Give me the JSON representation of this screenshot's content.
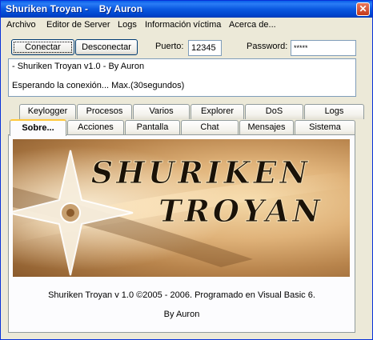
{
  "window": {
    "title": "Shuriken Troyan -    By Auron",
    "close_glyph": "✕"
  },
  "menu": [
    "Archivo",
    "Editor de Server",
    "Logs",
    "Información víctima",
    "Acerca de..."
  ],
  "toolbar": {
    "connect_label": "Conectar",
    "disconnect_label": "Desconectar",
    "port_label": "Puerto:",
    "port_value": "12345",
    "password_label": "Password:",
    "password_value": "*****"
  },
  "log": {
    "line1": "- Shuriken Troyan v1.0 -     By Auron",
    "line2": "Esperando la conexión... Max.(30segundos)"
  },
  "tabs_row1": [
    "Keylogger",
    "Procesos",
    "Varios",
    "Explorer",
    "DoS",
    "Logs"
  ],
  "tabs_row2": [
    "Sobre...",
    "Acciones",
    "Pantalla",
    "Chat",
    "Mensajes",
    "Sistema"
  ],
  "active_tab": "Sobre...",
  "about": {
    "banner_line1": "SHURIKEN",
    "banner_line2": "TROYAN",
    "credits": "Shuriken Troyan v 1.0 ©2005 - 2006. Programado en Visual Basic 6.",
    "author": "By Auron"
  }
}
